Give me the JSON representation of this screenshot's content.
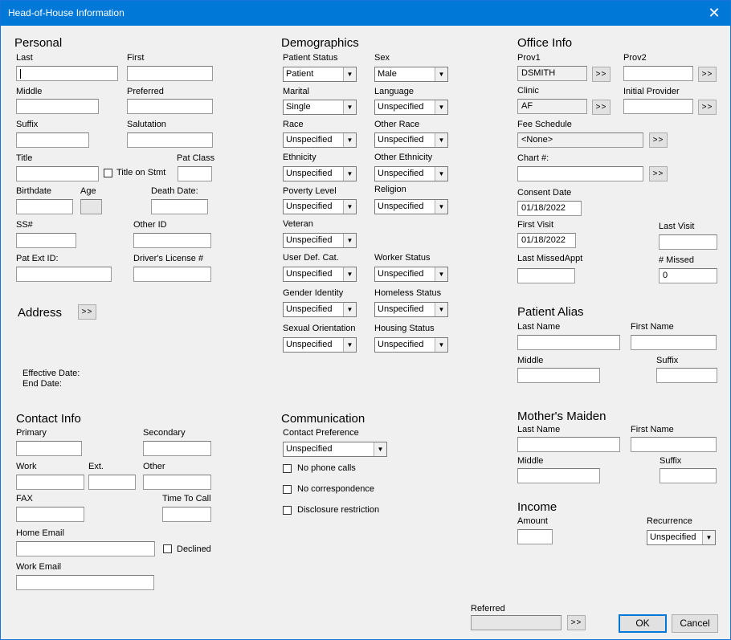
{
  "window": {
    "title": "Head-of-House Information",
    "close_glyph": "✕"
  },
  "personal": {
    "header": "Personal",
    "last_label": "Last",
    "first_label": "First",
    "middle_label": "Middle",
    "preferred_label": "Preferred",
    "suffix_label": "Suffix",
    "salutation_label": "Salutation",
    "title_label": "Title",
    "title_on_stmt_label": "Title on Stmt",
    "pat_class_label": "Pat Class",
    "birthdate_label": "Birthdate",
    "age_label": "Age",
    "death_date_label": "Death Date:",
    "ssn_label": "SS#",
    "other_id_label": "Other ID",
    "pat_ext_id_label": "Pat Ext ID:",
    "drivers_license_label": "Driver's License #"
  },
  "address": {
    "header": "Address",
    "button_label": ">>",
    "effective_date_label": "Effective Date:",
    "end_date_label": "End Date:"
  },
  "contact": {
    "header": "Contact Info",
    "primary_label": "Primary",
    "secondary_label": "Secondary",
    "work_label": "Work",
    "ext_label": "Ext.",
    "other_label": "Other",
    "fax_label": "FAX",
    "time_to_call_label": "Time To Call",
    "home_email_label": "Home Email",
    "declined_label": "Declined",
    "work_email_label": "Work Email"
  },
  "demographics": {
    "header": "Demographics",
    "patient_status": {
      "label": "Patient Status",
      "value": "Patient"
    },
    "sex": {
      "label": "Sex",
      "value": "Male"
    },
    "marital": {
      "label": "Marital",
      "value": "Single"
    },
    "language": {
      "label": "Language",
      "value": "Unspecified"
    },
    "race": {
      "label": "Race",
      "value": "Unspecified"
    },
    "other_race": {
      "label": "Other Race",
      "value": "Unspecified"
    },
    "ethnicity": {
      "label": "Ethnicity",
      "value": "Unspecified"
    },
    "other_ethnicity": {
      "label": "Other Ethnicity",
      "value": "Unspecified"
    },
    "poverty_level": {
      "label": "Poverty Level",
      "value": "Unspecified"
    },
    "religion": {
      "label": "Religion",
      "value": "Unspecified"
    },
    "veteran": {
      "label": "Veteran",
      "value": "Unspecified"
    },
    "user_def_cat": {
      "label": "User Def. Cat.",
      "value": "Unspecified"
    },
    "worker_status": {
      "label": "Worker Status",
      "value": "Unspecified"
    },
    "gender_identity": {
      "label": "Gender Identity",
      "value": "Unspecified"
    },
    "homeless_status": {
      "label": "Homeless Status",
      "value": "Unspecified"
    },
    "sexual_orientation": {
      "label": "Sexual Orientation",
      "value": "Unspecified"
    },
    "housing_status": {
      "label": "Housing Status",
      "value": "Unspecified"
    }
  },
  "communication": {
    "header": "Communication",
    "contact_preference": {
      "label": "Contact Preference",
      "value": "Unspecified"
    },
    "no_phone_calls_label": "No phone calls",
    "no_correspondence_label": "No correspondence",
    "disclosure_restriction_label": "Disclosure restriction"
  },
  "office": {
    "header": "Office Info",
    "prov1": {
      "label": "Prov1",
      "value": "DSMITH"
    },
    "prov2": {
      "label": "Prov2",
      "value": ""
    },
    "clinic": {
      "label": "Clinic",
      "value": "AF"
    },
    "initial_provider": {
      "label": "Initial Provider",
      "value": ""
    },
    "fee_schedule": {
      "label": "Fee Schedule",
      "value": "<None>"
    },
    "chart": {
      "label": "Chart #:",
      "value": ""
    },
    "consent_date": {
      "label": "Consent Date",
      "value": "01/18/2022"
    },
    "first_visit": {
      "label": "First Visit",
      "value": "01/18/2022"
    },
    "last_visit": {
      "label": "Last Visit",
      "value": ""
    },
    "last_missed_appt": {
      "label": "Last MissedAppt",
      "value": ""
    },
    "missed": {
      "label": "# Missed",
      "value": "0"
    },
    "browse_label": ">>"
  },
  "alias": {
    "header": "Patient Alias",
    "last_name_label": "Last Name",
    "first_name_label": "First Name",
    "middle_label": "Middle",
    "suffix_label": "Suffix"
  },
  "maiden": {
    "header": "Mother's Maiden",
    "last_name_label": "Last Name",
    "first_name_label": "First Name",
    "middle_label": "Middle",
    "suffix_label": "Suffix"
  },
  "income": {
    "header": "Income",
    "amount_label": "Amount",
    "recurrence": {
      "label": "Recurrence",
      "value": "Unspecified"
    }
  },
  "footer": {
    "referred_label": "Referred",
    "referred_value": "",
    "browse_label": ">>",
    "ok_label": "OK",
    "cancel_label": "Cancel"
  }
}
